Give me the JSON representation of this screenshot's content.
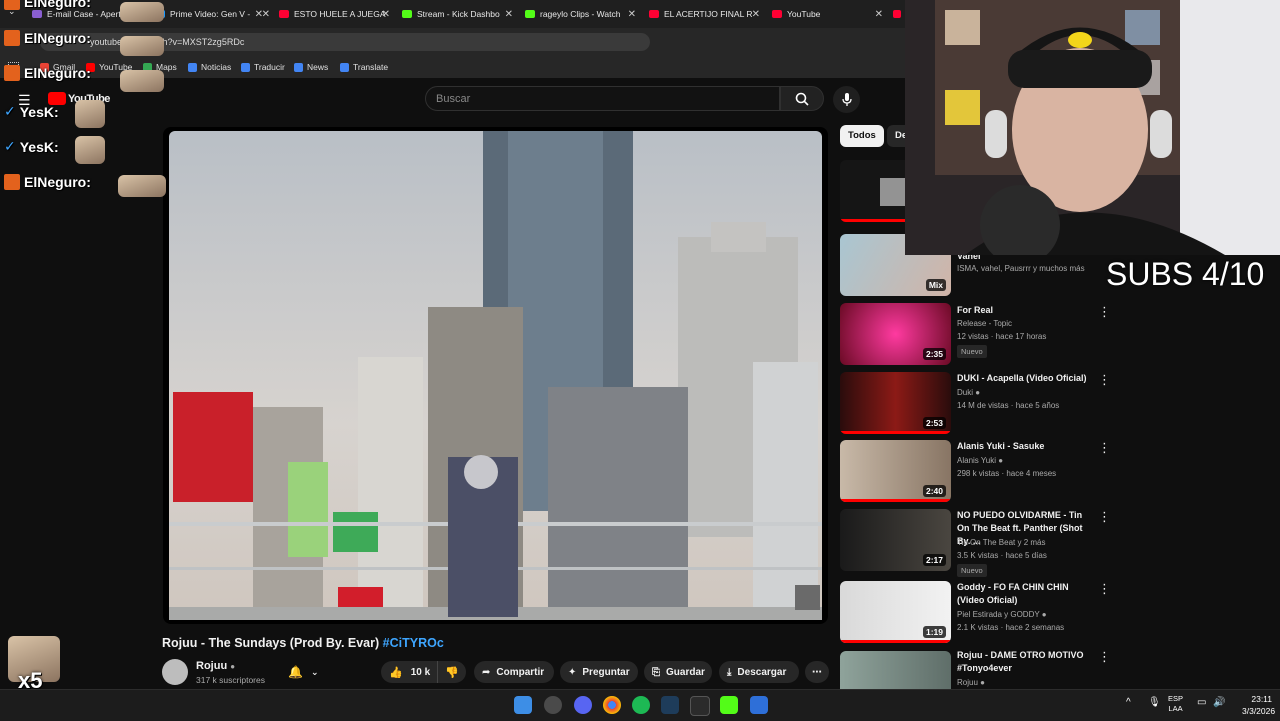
{
  "browser": {
    "tabs": [
      {
        "label": "E-mail Case - Apert",
        "color": "#8a5fd1"
      },
      {
        "label": "Prime Video: Gen V -",
        "color": "#1a98ff"
      },
      {
        "label": "ESTO HUELE A JUEGA",
        "color": "#ff0033"
      },
      {
        "label": "Stream - Kick Dashbo",
        "color": "#53fc18"
      },
      {
        "label": "rageylo Clips - Watch",
        "color": "#53fc18"
      },
      {
        "label": "EL ACERTIJO FINAL R",
        "color": "#ff0033"
      },
      {
        "label": "YouTube",
        "color": "#ff0033"
      }
    ],
    "url": "youtube.com/watch?v=MXST2zg5RDc",
    "bookmarks": [
      "Gmail",
      "YouTube",
      "Maps",
      "Noticias",
      "Traducir",
      "News",
      "Translate"
    ]
  },
  "youtube": {
    "logo": "YouTube",
    "search_placeholder": "Buscar",
    "video_title": "Rojuu - The Sundays (Prod By. Evar)",
    "video_hashtag": "#CiTYROc",
    "channel_name": "Rojuu",
    "channel_subs": "317 k suscriptores",
    "likes": "10 k",
    "actions": {
      "share": "Compartir",
      "ask": "Preguntar",
      "save": "Guardar",
      "download": "Descargar"
    },
    "chips": [
      "Todos",
      "De"
    ],
    "recommendations": [
      {
        "title": "",
        "meta1": "",
        "meta2": "",
        "duration": "",
        "badge": ""
      },
      {
        "title": "Vahel",
        "meta1": "ISMA, vahel, Pausrrr y muchos más",
        "meta2": "",
        "duration": "Mix",
        "badge": ""
      },
      {
        "title": "For Real",
        "meta1": "Release - Topic",
        "meta2": "12 vistas · hace 17 horas",
        "duration": "2:35",
        "badge": "Nuevo"
      },
      {
        "title": "DUKI - Acapella (Video Oficial)",
        "meta1": "Duki",
        "meta2": "14 M de vistas · hace 5 años",
        "duration": "2:53",
        "badge": ""
      },
      {
        "title": "Alanis Yuki - Sasuke",
        "meta1": "Alanis Yuki",
        "meta2": "298 k vistas · hace 4 meses",
        "duration": "2:40",
        "badge": ""
      },
      {
        "title": "NO PUEDO OLVIDARME - Tin On The Beat ft. Panther (Shot By. ...",
        "meta1": "Tin On The Beat y 2 más",
        "meta2": "3.5 K vistas · hace 5 días",
        "duration": "2:17",
        "badge": "Nuevo"
      },
      {
        "title": "Goddy - FO FA CHIN CHIN (Video Oficial)",
        "meta1": "Piel Estirada y GODDY",
        "meta2": "2.1 K vistas · hace 2 semanas",
        "duration": "1:19",
        "badge": ""
      },
      {
        "title": "Rojuu - DAME OTRO MOTIVO #Tonyo4ever",
        "meta1": "Rojuu",
        "meta2": "",
        "duration": "",
        "badge": ""
      }
    ]
  },
  "overlay": {
    "chat": [
      {
        "user": "ElNeguro:",
        "badge": "kick"
      },
      {
        "user": "ElNeguro:",
        "badge": "kick"
      },
      {
        "user": "ElNeguro:",
        "badge": "kick"
      },
      {
        "user": "YesK:",
        "badge": "check"
      },
      {
        "user": "YesK:",
        "badge": "check"
      },
      {
        "user": "ElNeguro:",
        "badge": "kick"
      }
    ],
    "combo": "x5",
    "subs_goal": "SUBS 4/10"
  },
  "taskbar": {
    "lang": "ESP",
    "lang2": "LAA",
    "time": "23:11",
    "date": "3/3/2026"
  },
  "colors": {
    "yt_red": "#ff0000",
    "link_blue": "#3ea6ff",
    "kick_green": "#53fc18"
  }
}
